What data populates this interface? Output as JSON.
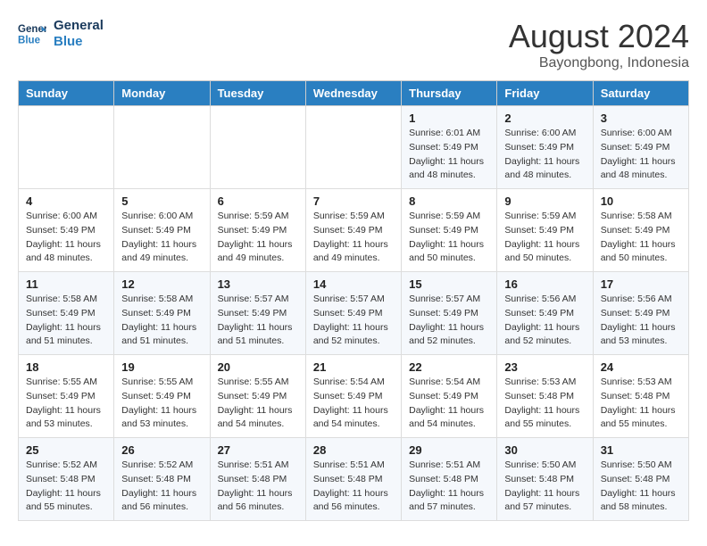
{
  "header": {
    "logo_general": "General",
    "logo_blue": "Blue",
    "title": "August 2024",
    "subtitle": "Bayongbong, Indonesia"
  },
  "weekdays": [
    "Sunday",
    "Monday",
    "Tuesday",
    "Wednesday",
    "Thursday",
    "Friday",
    "Saturday"
  ],
  "weeks": [
    [
      {
        "day": "",
        "info": ""
      },
      {
        "day": "",
        "info": ""
      },
      {
        "day": "",
        "info": ""
      },
      {
        "day": "",
        "info": ""
      },
      {
        "day": "1",
        "info": "Sunrise: 6:01 AM\nSunset: 5:49 PM\nDaylight: 11 hours\nand 48 minutes."
      },
      {
        "day": "2",
        "info": "Sunrise: 6:00 AM\nSunset: 5:49 PM\nDaylight: 11 hours\nand 48 minutes."
      },
      {
        "day": "3",
        "info": "Sunrise: 6:00 AM\nSunset: 5:49 PM\nDaylight: 11 hours\nand 48 minutes."
      }
    ],
    [
      {
        "day": "4",
        "info": "Sunrise: 6:00 AM\nSunset: 5:49 PM\nDaylight: 11 hours\nand 48 minutes."
      },
      {
        "day": "5",
        "info": "Sunrise: 6:00 AM\nSunset: 5:49 PM\nDaylight: 11 hours\nand 49 minutes."
      },
      {
        "day": "6",
        "info": "Sunrise: 5:59 AM\nSunset: 5:49 PM\nDaylight: 11 hours\nand 49 minutes."
      },
      {
        "day": "7",
        "info": "Sunrise: 5:59 AM\nSunset: 5:49 PM\nDaylight: 11 hours\nand 49 minutes."
      },
      {
        "day": "8",
        "info": "Sunrise: 5:59 AM\nSunset: 5:49 PM\nDaylight: 11 hours\nand 50 minutes."
      },
      {
        "day": "9",
        "info": "Sunrise: 5:59 AM\nSunset: 5:49 PM\nDaylight: 11 hours\nand 50 minutes."
      },
      {
        "day": "10",
        "info": "Sunrise: 5:58 AM\nSunset: 5:49 PM\nDaylight: 11 hours\nand 50 minutes."
      }
    ],
    [
      {
        "day": "11",
        "info": "Sunrise: 5:58 AM\nSunset: 5:49 PM\nDaylight: 11 hours\nand 51 minutes."
      },
      {
        "day": "12",
        "info": "Sunrise: 5:58 AM\nSunset: 5:49 PM\nDaylight: 11 hours\nand 51 minutes."
      },
      {
        "day": "13",
        "info": "Sunrise: 5:57 AM\nSunset: 5:49 PM\nDaylight: 11 hours\nand 51 minutes."
      },
      {
        "day": "14",
        "info": "Sunrise: 5:57 AM\nSunset: 5:49 PM\nDaylight: 11 hours\nand 52 minutes."
      },
      {
        "day": "15",
        "info": "Sunrise: 5:57 AM\nSunset: 5:49 PM\nDaylight: 11 hours\nand 52 minutes."
      },
      {
        "day": "16",
        "info": "Sunrise: 5:56 AM\nSunset: 5:49 PM\nDaylight: 11 hours\nand 52 minutes."
      },
      {
        "day": "17",
        "info": "Sunrise: 5:56 AM\nSunset: 5:49 PM\nDaylight: 11 hours\nand 53 minutes."
      }
    ],
    [
      {
        "day": "18",
        "info": "Sunrise: 5:55 AM\nSunset: 5:49 PM\nDaylight: 11 hours\nand 53 minutes."
      },
      {
        "day": "19",
        "info": "Sunrise: 5:55 AM\nSunset: 5:49 PM\nDaylight: 11 hours\nand 53 minutes."
      },
      {
        "day": "20",
        "info": "Sunrise: 5:55 AM\nSunset: 5:49 PM\nDaylight: 11 hours\nand 54 minutes."
      },
      {
        "day": "21",
        "info": "Sunrise: 5:54 AM\nSunset: 5:49 PM\nDaylight: 11 hours\nand 54 minutes."
      },
      {
        "day": "22",
        "info": "Sunrise: 5:54 AM\nSunset: 5:49 PM\nDaylight: 11 hours\nand 54 minutes."
      },
      {
        "day": "23",
        "info": "Sunrise: 5:53 AM\nSunset: 5:48 PM\nDaylight: 11 hours\nand 55 minutes."
      },
      {
        "day": "24",
        "info": "Sunrise: 5:53 AM\nSunset: 5:48 PM\nDaylight: 11 hours\nand 55 minutes."
      }
    ],
    [
      {
        "day": "25",
        "info": "Sunrise: 5:52 AM\nSunset: 5:48 PM\nDaylight: 11 hours\nand 55 minutes."
      },
      {
        "day": "26",
        "info": "Sunrise: 5:52 AM\nSunset: 5:48 PM\nDaylight: 11 hours\nand 56 minutes."
      },
      {
        "day": "27",
        "info": "Sunrise: 5:51 AM\nSunset: 5:48 PM\nDaylight: 11 hours\nand 56 minutes."
      },
      {
        "day": "28",
        "info": "Sunrise: 5:51 AM\nSunset: 5:48 PM\nDaylight: 11 hours\nand 56 minutes."
      },
      {
        "day": "29",
        "info": "Sunrise: 5:51 AM\nSunset: 5:48 PM\nDaylight: 11 hours\nand 57 minutes."
      },
      {
        "day": "30",
        "info": "Sunrise: 5:50 AM\nSunset: 5:48 PM\nDaylight: 11 hours\nand 57 minutes."
      },
      {
        "day": "31",
        "info": "Sunrise: 5:50 AM\nSunset: 5:48 PM\nDaylight: 11 hours\nand 58 minutes."
      }
    ]
  ]
}
